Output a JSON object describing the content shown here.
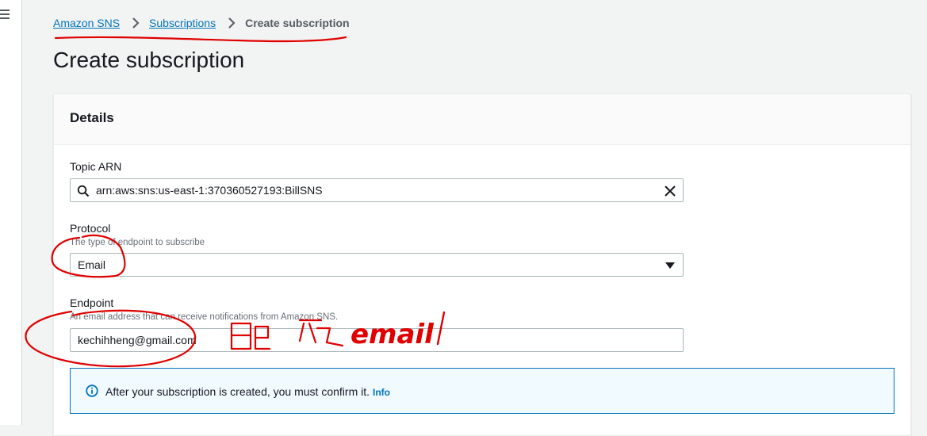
{
  "breadcrumb": {
    "items": [
      "Amazon SNS",
      "Subscriptions"
    ],
    "current": "Create subscription"
  },
  "page_title": "Create subscription",
  "details": {
    "title": "Details",
    "topic_arn": {
      "label": "Topic ARN",
      "value": "arn:aws:sns:us-east-1:370360527193:BillSNS",
      "icon": "search-icon",
      "clear_icon": "close-icon"
    },
    "protocol": {
      "label": "Protocol",
      "description": "The type of endpoint to subscribe",
      "selected": "Email",
      "icon": "caret-down-icon"
    },
    "endpoint": {
      "label": "Endpoint",
      "description": "An email address that can receive notifications from Amazon SNS.",
      "value": "kechihheng@gmail.com"
    },
    "alert": {
      "text": "After your subscription is created, you must confirm it.",
      "link": "Info",
      "icon": "info-icon"
    }
  },
  "annotations": {
    "handwritten_note": "email",
    "color": "#e00000"
  },
  "colors": {
    "link": "#0073bb",
    "background": "#f2f3f3",
    "alert_bg": "#f1faff",
    "annotation": "#e00000"
  }
}
